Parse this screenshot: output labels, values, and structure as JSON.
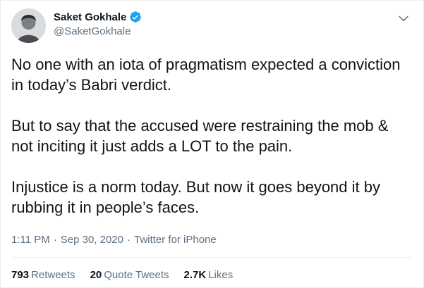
{
  "author": {
    "display_name": "Saket Gokhale",
    "handle": "@SaketGokhale",
    "verified": true
  },
  "tweet": {
    "text": "No one with an iota of pragmatism expected a conviction in today’s Babri verdict.\n\nBut to say that the accused were restraining the mob & not inciting it just adds a LOT to the pain.\n\nInjustice is a norm today. But now it goes beyond it by rubbing it in people’s faces.",
    "time": "1:11 PM",
    "date": "Sep 30, 2020",
    "separator": "·",
    "source": "Twitter for iPhone"
  },
  "stats": {
    "retweets_count": "793",
    "retweets_label": "Retweets",
    "quote_tweets_count": "20",
    "quote_tweets_label": "Quote Tweets",
    "likes_count": "2.7K",
    "likes_label": "Likes"
  },
  "colors": {
    "text_primary": "#0f1419",
    "text_secondary": "#5b7083",
    "verified_blue": "#1da1f2",
    "divider": "#ebeef0"
  },
  "icons": {
    "verified": "verified-badge-icon",
    "more": "chevron-down-icon"
  }
}
